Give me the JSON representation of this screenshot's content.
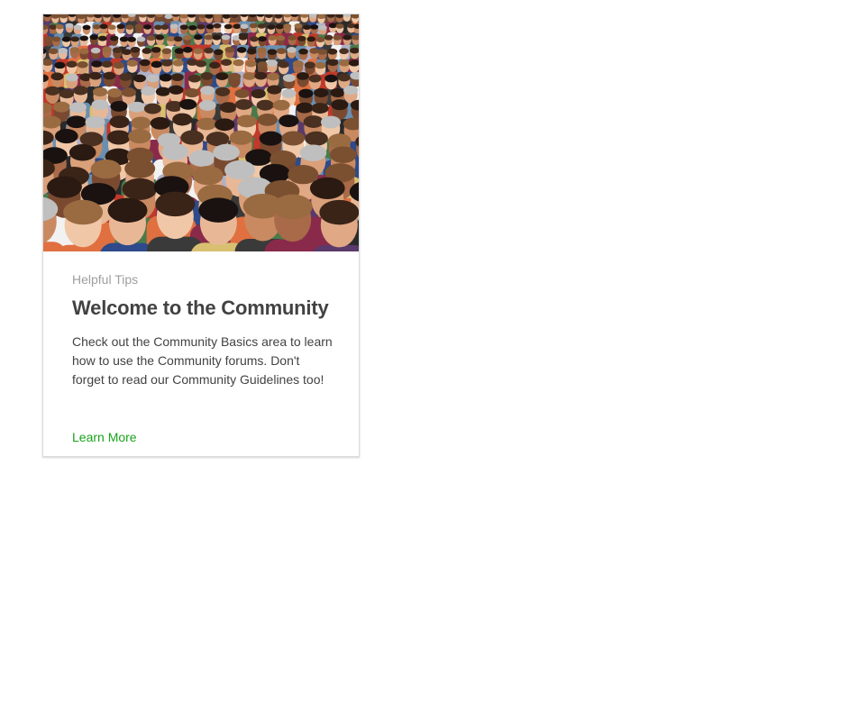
{
  "card": {
    "image_alt": "crowd-photo",
    "eyebrow": "Helpful Tips",
    "title": "Welcome to the Community",
    "description": "Check out the Community Basics area to learn how to use the Community forums. Don't forget to read our Community Guidelines too!",
    "cta_label": "Learn More",
    "accent_color": "#1aa31a"
  }
}
